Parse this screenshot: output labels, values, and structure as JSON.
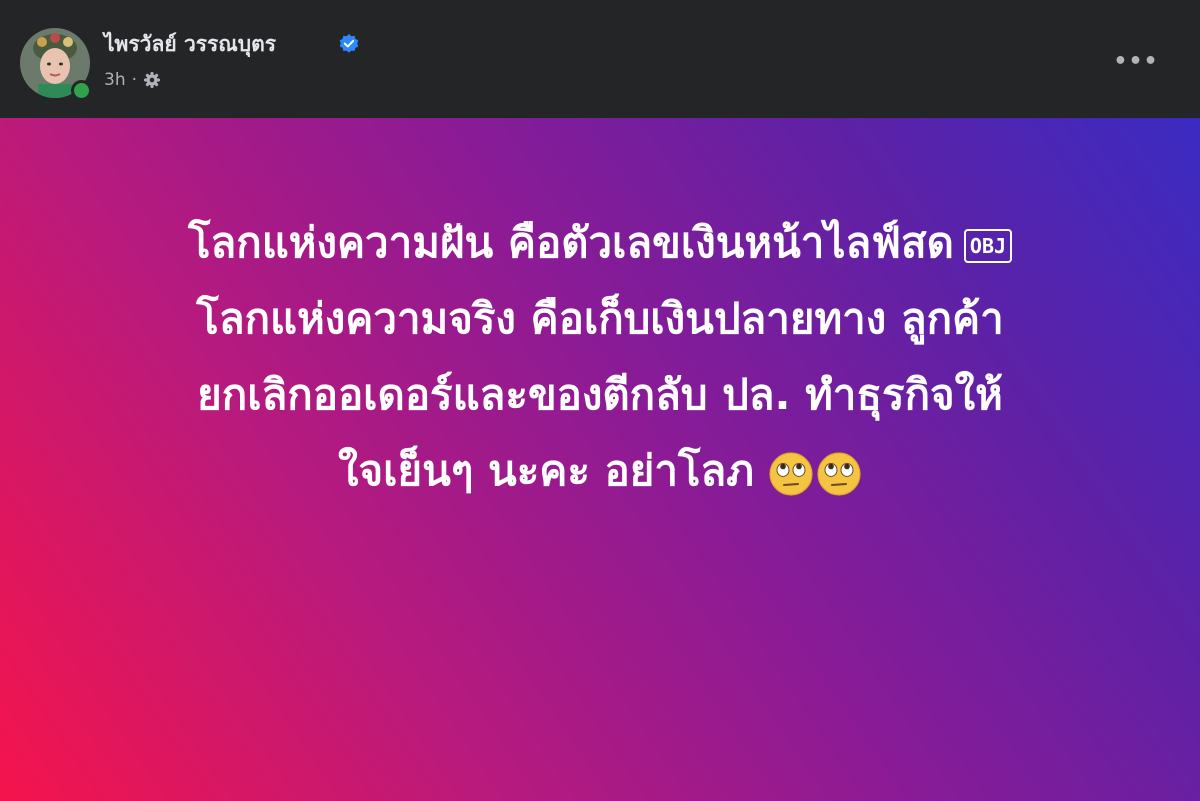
{
  "post": {
    "author_name": "ไพรวัลย์ วรรณบุตร",
    "verified_icon": "verified-badge-icon",
    "time": "3h",
    "separator": "·",
    "audience_icon": "gear-icon",
    "more_icon": "more-options-icon",
    "more_label": "•••",
    "avatar_icon": "profile-avatar",
    "online_status_color": "#31a24c",
    "background_gradient": [
      "#f5144c",
      "#8a1b96",
      "#3b2bc2"
    ],
    "text_lines": [
      "โลกแห่งความฝัน คือตัวเลขเงินหน้าไลฟ์สด",
      "โลกแห่งความจริง คือเก็บเงินปลายทาง ลูกค้า",
      "ยกเลิกออเดอร์และของตีกลับ ปล. ทำธุรกิจให้",
      "ใจเย็นๆ นะคะ อย่าโลภ"
    ],
    "obj_placeholder": "OBJ",
    "emoji_icon": "face-with-rolling-eyes-icon"
  }
}
